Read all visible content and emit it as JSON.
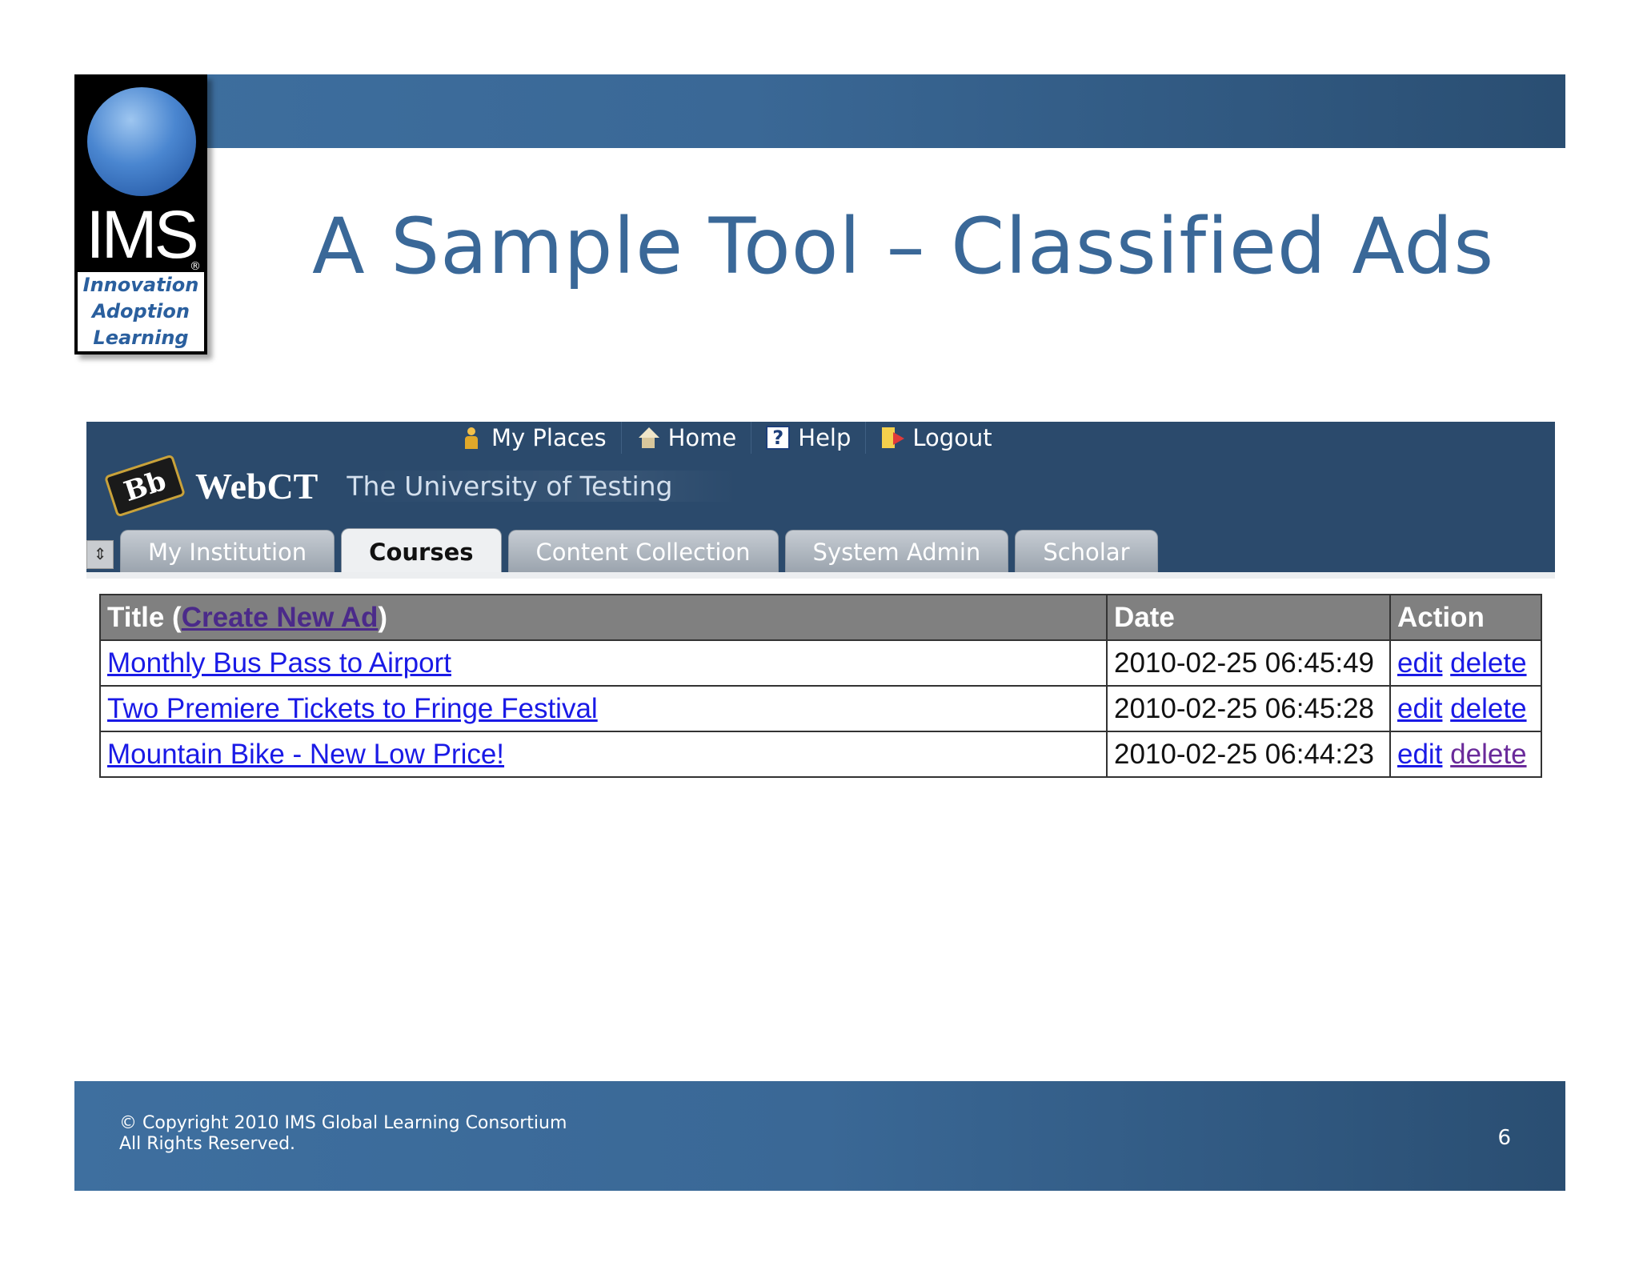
{
  "slide": {
    "title": "A Sample Tool – Classified Ads",
    "page_number": "6",
    "copyright_line1": "© Copyright 2010 IMS Global Learning Consortium",
    "copyright_line2": "All Rights Reserved."
  },
  "logo": {
    "name": "IMS",
    "registered": "®",
    "tagline": [
      "Innovation",
      "Adoption",
      "Learning"
    ]
  },
  "lms": {
    "top_links": [
      {
        "label": "My Places",
        "icon": "person-icon"
      },
      {
        "label": "Home",
        "icon": "home-icon"
      },
      {
        "label": "Help",
        "icon": "help-icon"
      },
      {
        "label": "Logout",
        "icon": "logout-icon"
      }
    ],
    "brand_badge": "Bb",
    "brand": "WebCT",
    "institution": "The University of Testing",
    "tabs": [
      {
        "label": "My Institution",
        "active": false
      },
      {
        "label": "Courses",
        "active": true
      },
      {
        "label": "Content Collection",
        "active": false
      },
      {
        "label": "System Admin",
        "active": false
      },
      {
        "label": "Scholar",
        "active": false
      }
    ]
  },
  "table": {
    "header": {
      "title_prefix": "Title (",
      "create_link": "Create New Ad",
      "title_suffix": ")",
      "date": "Date",
      "action": "Action"
    },
    "rows": [
      {
        "title": "Monthly Bus Pass to Airport",
        "date": "2010-02-25 06:45:49",
        "edit": "edit",
        "delete": "delete"
      },
      {
        "title": "Two Premiere Tickets to Fringe Festival",
        "date": "2010-02-25 06:45:28",
        "edit": "edit",
        "delete": "delete"
      },
      {
        "title": "Mountain Bike - New Low Price!",
        "date": "2010-02-25 06:44:23",
        "edit": "edit",
        "delete": "delete"
      }
    ]
  },
  "colors": {
    "band": "#3a6896",
    "title_text": "#3a6898",
    "lms_header": "#2b4a6c",
    "table_header": "#808080",
    "link": "#1a1ae6"
  }
}
